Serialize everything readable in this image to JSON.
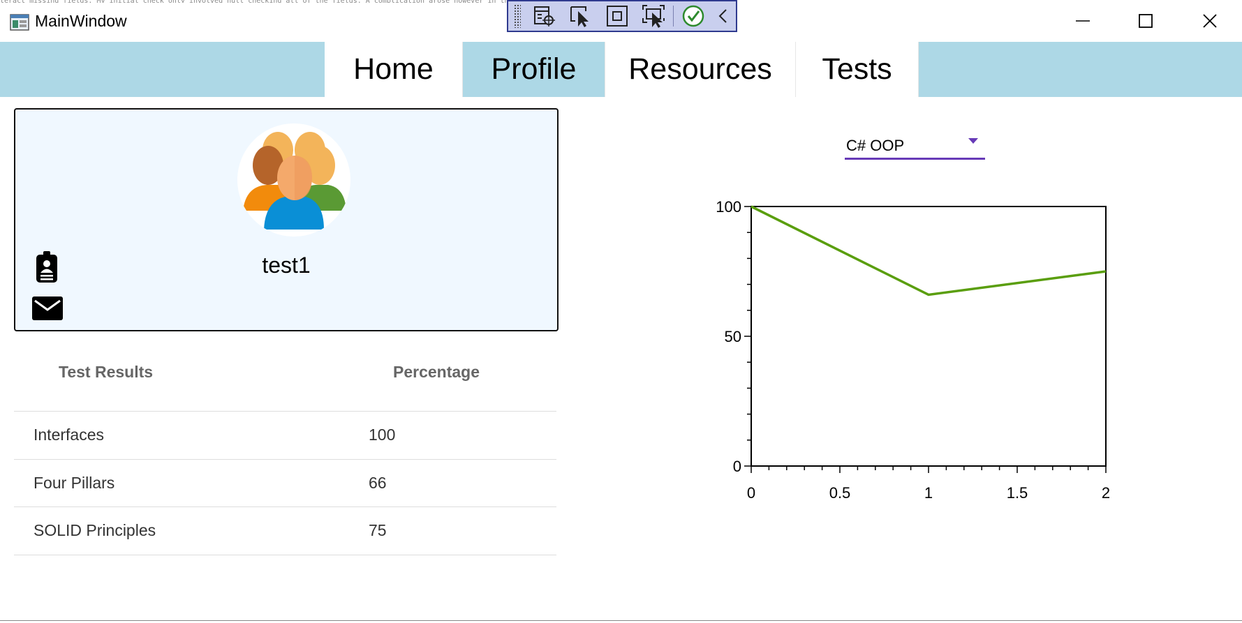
{
  "window": {
    "title": "MainWindow",
    "background_text": "teract missing fields. My initial check only involved null checking all of the fields. A complication arose however in the scenario where a user enters something in a"
  },
  "debug_toolbar": {
    "buttons": [
      "select-element-icon",
      "select-pointer-icon",
      "display-layout-adorners-icon",
      "track-focused-element-icon",
      "binding-failures-check-icon",
      "collapse-icon"
    ]
  },
  "nav": {
    "tabs": [
      {
        "label": "Home",
        "active": false
      },
      {
        "label": "Profile",
        "active": true
      },
      {
        "label": "Resources",
        "active": false
      },
      {
        "label": "Tests",
        "active": false
      }
    ],
    "bar_color": "#add8e6"
  },
  "profile": {
    "username": "test1",
    "card_background": "#f0f8ff"
  },
  "results": {
    "headers": [
      "Test Results",
      "Percentage"
    ],
    "rows": [
      {
        "test": "Interfaces",
        "percentage": "100"
      },
      {
        "test": "Four Pillars",
        "percentage": "66"
      },
      {
        "test": "SOLID Principles",
        "percentage": "75"
      }
    ]
  },
  "course_selector": {
    "selected": "C# OOP",
    "accent": "#673ab7"
  },
  "chart_data": {
    "type": "line",
    "x": [
      0,
      1,
      2
    ],
    "series": [
      {
        "values": [
          100,
          66,
          75
        ],
        "color": "#5a9e0e"
      }
    ],
    "xlim": [
      0,
      2
    ],
    "ylim": [
      0,
      100
    ],
    "x_ticks": [
      "0",
      "0.5",
      "1",
      "1.5",
      "2"
    ],
    "y_ticks": [
      "0",
      "50",
      "100"
    ],
    "grid": false,
    "title": "",
    "xlabel": "",
    "ylabel": ""
  }
}
